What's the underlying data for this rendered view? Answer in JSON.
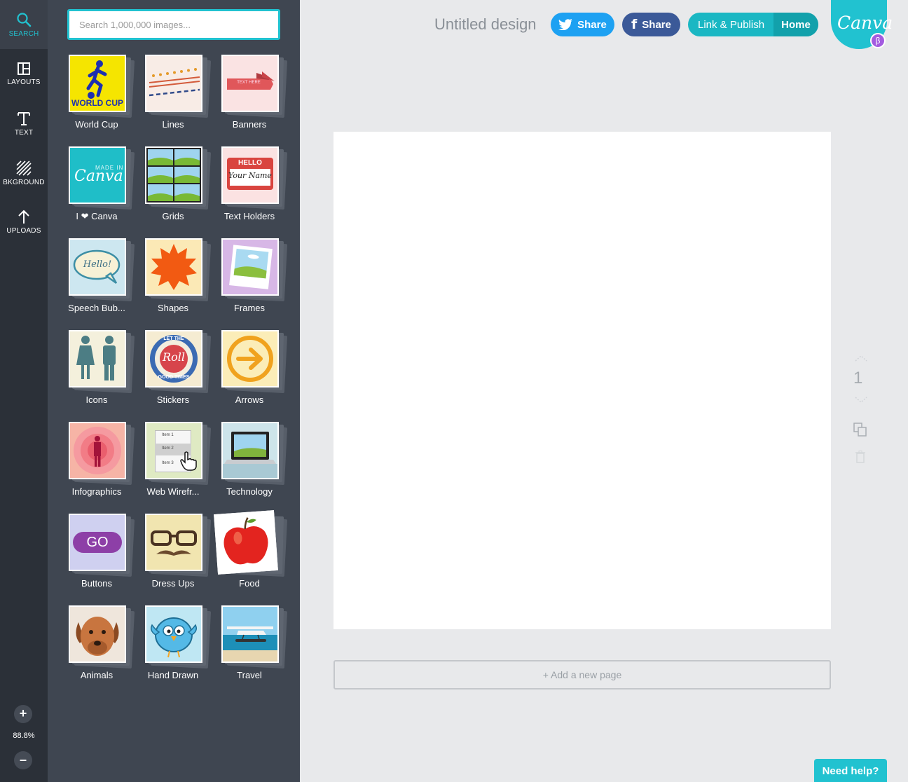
{
  "rail": {
    "items": [
      {
        "label": "SEARCH",
        "icon": "search-icon"
      },
      {
        "label": "LAYOUTS",
        "icon": "layouts-icon"
      },
      {
        "label": "TEXT",
        "icon": "text-icon"
      },
      {
        "label": "BKGROUND",
        "icon": "background-icon"
      },
      {
        "label": "UPLOADS",
        "icon": "upload-icon"
      }
    ],
    "zoom_in": "+",
    "zoom_out": "–",
    "zoom_level": "88.8%"
  },
  "library": {
    "search_placeholder": "Search 1,000,000 images...",
    "categories": [
      "World Cup",
      "Lines",
      "Banners",
      "I ❤ Canva",
      "Grids",
      "Text Holders",
      "Speech Bub...",
      "Shapes",
      "Frames",
      "Icons",
      "Stickers",
      "Arrows",
      "Infographics",
      "Web Wirefr...",
      "Technology",
      "Buttons",
      "Dress Ups",
      "Food",
      "Animals",
      "Hand Drawn",
      "Travel"
    ],
    "thumb_text": {
      "world_cup": "WORLD CUP",
      "banner": "TEXT HERE",
      "made_in": "MADE IN",
      "canva": "Canva",
      "hello": "HELLO",
      "your_name": "Your Name",
      "hello_bubble": "Hello!",
      "roll": "Roll",
      "let_the": "LET THE",
      "good_times": "GOOD TIMES",
      "item1": "Item 1",
      "item2": "Item 2",
      "item3": "Item 3",
      "go": "GO"
    }
  },
  "header": {
    "title": "Untitled design",
    "twitter_share": "Share",
    "facebook_share": "Share",
    "link_publish": "Link & Publish",
    "home": "Home",
    "logo": "Canva",
    "beta": "β"
  },
  "canvas": {
    "page_number": "1",
    "add_page": "+ Add a new page"
  },
  "help": "Need help?",
  "colors": {
    "accent": "#21c2d0",
    "twitter": "#1da1f2",
    "facebook": "#3b5998",
    "rail_bg": "#2b3038",
    "panel_bg": "#3f4651"
  }
}
